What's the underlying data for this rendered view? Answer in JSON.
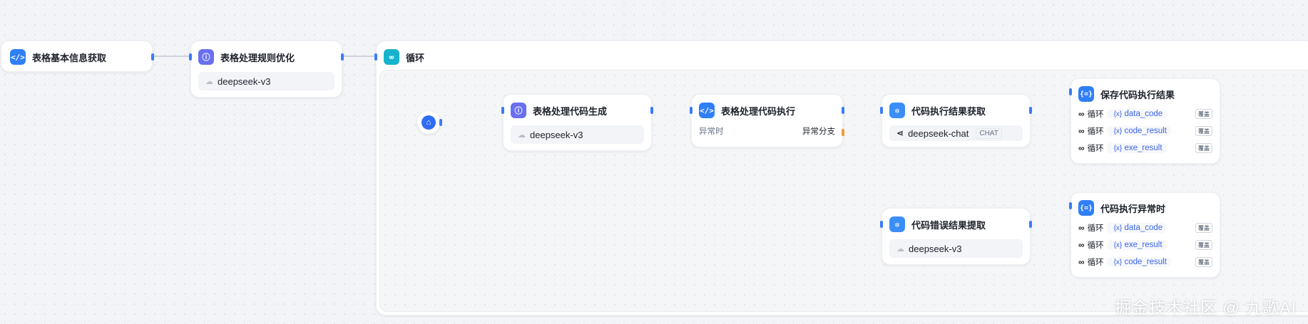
{
  "nodes": {
    "table_info": {
      "title": "表格基本信息获取",
      "icon": "code-icon"
    },
    "rule_opt": {
      "title": "表格处理规则优化",
      "icon": "llm-icon",
      "model": "deepseek-v3"
    },
    "loop": {
      "title": "循环",
      "icon": "loop-icon"
    },
    "start": {
      "icon": "home-icon"
    },
    "code_gen": {
      "title": "表格处理代码生成",
      "icon": "llm-icon",
      "model": "deepseek-v3"
    },
    "code_exec": {
      "title": "表格处理代码执行",
      "icon": "code-icon",
      "exception_label": "异常时",
      "exception_branch": "异常分支"
    },
    "result_get": {
      "title": "代码执行结果获取",
      "icon": "agent-icon",
      "model": "deepseek-chat",
      "model_tag": "CHAT"
    },
    "error_get": {
      "title": "代码错误结果提取",
      "icon": "agent-icon",
      "model": "deepseek-v3"
    },
    "save_result": {
      "title": "保存代码执行结果",
      "icon": "variable-icon",
      "rows": [
        {
          "source": "循环",
          "var": "data_code",
          "action": "覆盖"
        },
        {
          "source": "循环",
          "var": "code_result",
          "action": "覆盖"
        },
        {
          "source": "循环",
          "var": "exe_result",
          "action": "覆盖"
        }
      ]
    },
    "on_error": {
      "title": "代码执行异常时",
      "icon": "variable-icon",
      "rows": [
        {
          "source": "循环",
          "var": "data_code",
          "action": "覆盖"
        },
        {
          "source": "循环",
          "var": "exe_result",
          "action": "覆盖"
        },
        {
          "source": "循环",
          "var": "code_result",
          "action": "覆盖"
        }
      ]
    }
  },
  "symbols": {
    "var_prefix": "{x}"
  },
  "watermark": "掘金技术社区 @ 九歌AI",
  "colors": {
    "handle": "#3b7cf5",
    "edge": "#c3cad4",
    "exception_handle": "#f59a3b"
  }
}
